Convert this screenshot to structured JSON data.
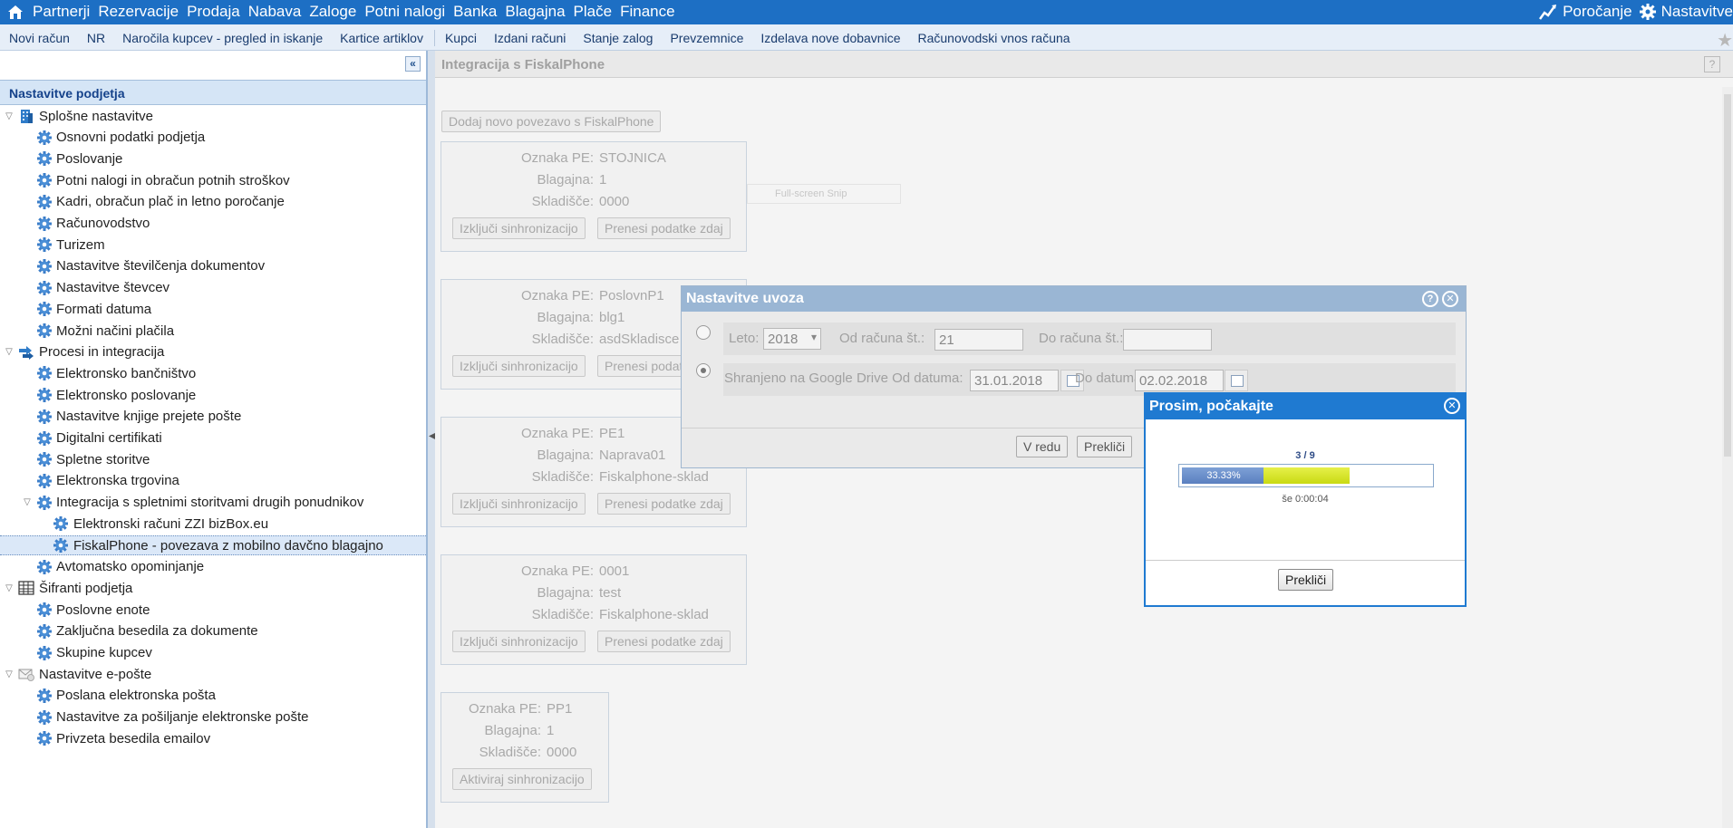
{
  "top_menu": {
    "items": [
      "Partnerji",
      "Rezervacije",
      "Prodaja",
      "Nabava",
      "Zaloge",
      "Potni nalogi",
      "Banka",
      "Blagajna",
      "Plače",
      "Finance"
    ],
    "right": {
      "reporting": "Poročanje",
      "settings": "Nastavitve"
    },
    "home_icon": "home-icon"
  },
  "toolbar": {
    "group1": [
      "Novi račun",
      "NR",
      "Naročila kupcev - pregled in iskanje",
      "Kartice artiklov"
    ],
    "group2": [
      "Kupci",
      "Izdani računi",
      "Stanje zalog",
      "Prevzemnice",
      "Izdelava nove dobavnice",
      "Računovodski vnos računa"
    ]
  },
  "left_panel": {
    "title": "Nastavitve podjetja",
    "tree": [
      {
        "label": "Splošne nastavitve",
        "level": 0,
        "icon": "building-icon",
        "expanded": true
      },
      {
        "label": "Osnovni podatki podjetja",
        "level": 1,
        "icon": "gear-icon"
      },
      {
        "label": "Poslovanje",
        "level": 1,
        "icon": "gear-icon"
      },
      {
        "label": "Potni nalogi in obračun potnih stroškov",
        "level": 1,
        "icon": "gear-icon"
      },
      {
        "label": "Kadri, obračun plač in letno poročanje",
        "level": 1,
        "icon": "gear-icon"
      },
      {
        "label": "Računovodstvo",
        "level": 1,
        "icon": "gear-icon"
      },
      {
        "label": "Turizem",
        "level": 1,
        "icon": "gear-icon"
      },
      {
        "label": "Nastavitve številčenja dokumentov",
        "level": 1,
        "icon": "gear-icon"
      },
      {
        "label": "Nastavitve števcev",
        "level": 1,
        "icon": "gear-icon"
      },
      {
        "label": "Formati datuma",
        "level": 1,
        "icon": "gear-icon"
      },
      {
        "label": "Možni načini plačila",
        "level": 1,
        "icon": "gear-icon"
      },
      {
        "label": "Procesi in integracija",
        "level": 0,
        "icon": "process-icon",
        "expanded": true
      },
      {
        "label": "Elektronsko bančništvo",
        "level": 1,
        "icon": "gear-icon"
      },
      {
        "label": "Elektronsko poslovanje",
        "level": 1,
        "icon": "gear-icon"
      },
      {
        "label": "Nastavitve knjige prejete pošte",
        "level": 1,
        "icon": "gear-icon"
      },
      {
        "label": "Digitalni certifikati",
        "level": 1,
        "icon": "gear-icon"
      },
      {
        "label": "Spletne storitve",
        "level": 1,
        "icon": "gear-icon"
      },
      {
        "label": "Elektronska trgovina",
        "level": 1,
        "icon": "gear-icon"
      },
      {
        "label": "Integracija s spletnimi storitvami drugih ponudnikov",
        "level": 1,
        "icon": "gear-icon",
        "expanded": true
      },
      {
        "label": "Elektronski računi ZZI bizBox.eu",
        "level": 2,
        "icon": "gear-icon"
      },
      {
        "label": "FiskalPhone - povezava z mobilno davčno blagajno",
        "level": 2,
        "icon": "gear-icon",
        "selected": true
      },
      {
        "label": "Avtomatsko opominjanje",
        "level": 1,
        "icon": "gear-icon"
      },
      {
        "label": "Šifranti podjetja",
        "level": 0,
        "icon": "table-icon",
        "expanded": true
      },
      {
        "label": "Poslovne enote",
        "level": 1,
        "icon": "gear-icon"
      },
      {
        "label": "Zaključna besedila za dokumente",
        "level": 1,
        "icon": "gear-icon"
      },
      {
        "label": "Skupine kupcev",
        "level": 1,
        "icon": "gear-icon"
      },
      {
        "label": "Nastavitve e-pošte",
        "level": 0,
        "icon": "mail-icon",
        "expanded": true
      },
      {
        "label": "Poslana elektronska pošta",
        "level": 1,
        "icon": "gear-icon"
      },
      {
        "label": "Nastavitve za pošiljanje elektronske pošte",
        "level": 1,
        "icon": "gear-icon"
      },
      {
        "label": "Privzeta besedila emailov",
        "level": 1,
        "icon": "gear-icon"
      }
    ]
  },
  "main": {
    "title": "Integracija s FiskalPhone",
    "help": "?",
    "add_button": "Dodaj novo povezavo s FiskalPhone",
    "fullscreen_label": "Full-screen Snip",
    "labels": {
      "pe": "Oznaka PE:",
      "register": "Blagajna:",
      "warehouse": "Skladišče:"
    },
    "cards": [
      {
        "pe": "STOJNICA",
        "register": "1",
        "warehouse": "0000",
        "btn1": "Izključi sinhronizacijo",
        "btn2": "Prenesi podatke zdaj"
      },
      {
        "pe": "PoslovnP1",
        "register": "blg1",
        "warehouse": "asdSkladisce",
        "btn1": "Izključi sinhronizacijo",
        "btn2": "Prenesi podatke zdaj"
      },
      {
        "pe": "PE1",
        "register": "Naprava01",
        "warehouse": "Fiskalphone-sklad",
        "btn1": "Izključi sinhronizacijo",
        "btn2": "Prenesi podatke zdaj"
      },
      {
        "pe": "0001",
        "register": "test",
        "warehouse": "Fiskalphone-sklad",
        "btn1": "Izključi sinhronizacijo",
        "btn2": "Prenesi podatke zdaj"
      },
      {
        "pe": "PP1",
        "register": "1",
        "warehouse": "0000",
        "btn1": "Aktiviraj sinhronizacijo"
      }
    ]
  },
  "import_dialog": {
    "title": "Nastavitve uvoza",
    "year_label": "Leto:",
    "year_value": "2018",
    "from_invoice_label": "Od računa št.:",
    "from_invoice_value": "21",
    "to_invoice_label": "Do računa št.:",
    "to_invoice_value": "",
    "drive_label": "Shranjeno na Google Drive Od datuma:",
    "from_date": "31.01.2018",
    "to_date_label": "Do datuma:",
    "to_date": "02.02.2018",
    "ok": "V redu",
    "cancel": "Prekliči",
    "selected_option": 2
  },
  "wait_dialog": {
    "title": "Prosim, počakajte",
    "counter": "3 / 9",
    "percent_label": "33.33%",
    "progress": 0.3333,
    "eta": "še 0:00:04",
    "cancel": "Prekliči"
  },
  "colors": {
    "accent": "#1d6fc4",
    "progress_blue": "#5a7fc0",
    "progress_yellow": "#c9da13"
  }
}
